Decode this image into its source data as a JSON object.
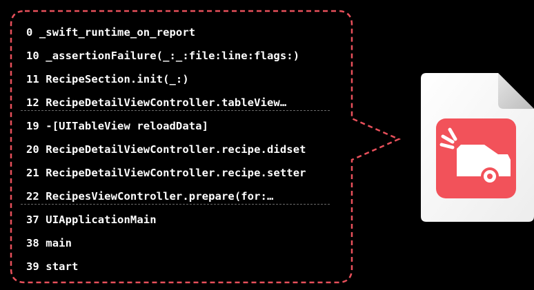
{
  "colors": {
    "background": "#000000",
    "callout_border": "#e8505b",
    "frame_text": "#ffffff",
    "separator": "#6a6a6a",
    "crash_icon": "#f2525a"
  },
  "icons": {
    "document": "crash-report-document-icon",
    "crash": "car-crash-icon"
  },
  "frames": [
    {
      "label": "0 _swift_runtime_on_report"
    },
    {
      "label": "10 _assertionFailure(_:_:file:line:flags:)"
    },
    {
      "label": "11 RecipeSection.init(_:)"
    },
    {
      "label": "12 RecipeDetailViewController.tableView…"
    },
    {
      "label": "19 -[UITableView reloadData]"
    },
    {
      "label": "20 RecipeDetailViewController.recipe.didset"
    },
    {
      "label": "21 RecipeDetailViewController.recipe.setter"
    },
    {
      "label": "22 RecipesViewController.prepare(for:…"
    },
    {
      "label": "37 UIApplicationMain"
    },
    {
      "label": "38 main"
    },
    {
      "label": "39 start"
    }
  ]
}
